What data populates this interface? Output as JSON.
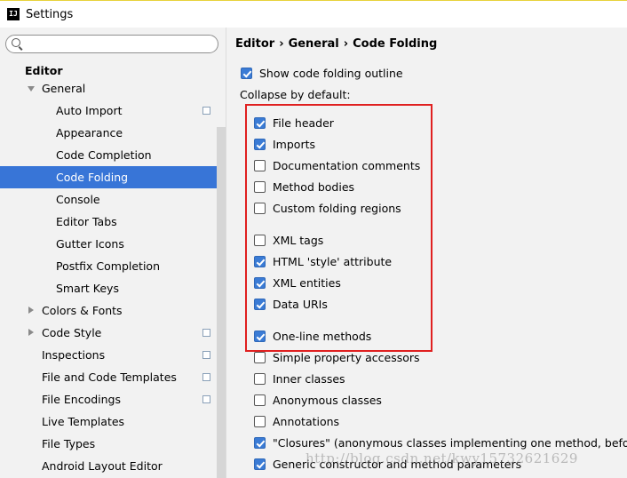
{
  "window": {
    "title": "Settings",
    "icon": "intellij-icon",
    "icon_text": "IJ"
  },
  "search": {
    "value": "",
    "placeholder": "",
    "icon": "search-icon"
  },
  "sidebar": {
    "items": [
      {
        "label": "Editor",
        "bold": true,
        "level": 0
      },
      {
        "label": "General",
        "level": 1,
        "expanded": true
      },
      {
        "label": "Auto Import",
        "level": 2,
        "copy_icon": true
      },
      {
        "label": "Appearance",
        "level": 2
      },
      {
        "label": "Code Completion",
        "level": 2
      },
      {
        "label": "Code Folding",
        "level": 2,
        "selected": true
      },
      {
        "label": "Console",
        "level": 2
      },
      {
        "label": "Editor Tabs",
        "level": 2
      },
      {
        "label": "Gutter Icons",
        "level": 2
      },
      {
        "label": "Postfix Completion",
        "level": 2
      },
      {
        "label": "Smart Keys",
        "level": 2
      },
      {
        "label": "Colors & Fonts",
        "level": 1,
        "collapsed": true
      },
      {
        "label": "Code Style",
        "level": 1,
        "collapsed": true,
        "copy_icon": true
      },
      {
        "label": "Inspections",
        "level": 1,
        "copy_icon": true
      },
      {
        "label": "File and Code Templates",
        "level": 1,
        "copy_icon": true
      },
      {
        "label": "File Encodings",
        "level": 1,
        "copy_icon": true
      },
      {
        "label": "Live Templates",
        "level": 1
      },
      {
        "label": "File Types",
        "level": 1
      },
      {
        "label": "Android Layout Editor",
        "level": 1
      }
    ]
  },
  "breadcrumb": {
    "parts": [
      "Editor",
      "General",
      "Code Folding"
    ],
    "separator": "›"
  },
  "show_outline": {
    "label": "Show code folding outline",
    "checked": true
  },
  "collapse_label": "Collapse by default:",
  "options": [
    {
      "label": "File header",
      "checked": true
    },
    {
      "label": "Imports",
      "checked": true
    },
    {
      "label": "Documentation comments",
      "checked": false
    },
    {
      "label": "Method bodies",
      "checked": false
    },
    {
      "label": "Custom folding regions",
      "checked": false
    },
    {
      "label": "XML tags",
      "checked": false
    },
    {
      "label": "HTML 'style' attribute",
      "checked": true
    },
    {
      "label": "XML entities",
      "checked": true
    },
    {
      "label": "Data URIs",
      "checked": true
    },
    {
      "label": "One-line methods",
      "checked": true
    },
    {
      "label": "Simple property accessors",
      "checked": false
    },
    {
      "label": "Inner classes",
      "checked": false
    },
    {
      "label": "Anonymous classes",
      "checked": false
    },
    {
      "label": "Annotations",
      "checked": false
    },
    {
      "label": "\"Closures\" (anonymous classes implementing one method, before Ja",
      "checked": true
    },
    {
      "label": "Generic constructor and method parameters",
      "checked": true
    }
  ],
  "watermark": "http://blog.csdn.net/kwy15732621629",
  "colors": {
    "selection": "#3875d7",
    "checkbox": "#3a7bd5",
    "highlight_box": "#e02020"
  }
}
